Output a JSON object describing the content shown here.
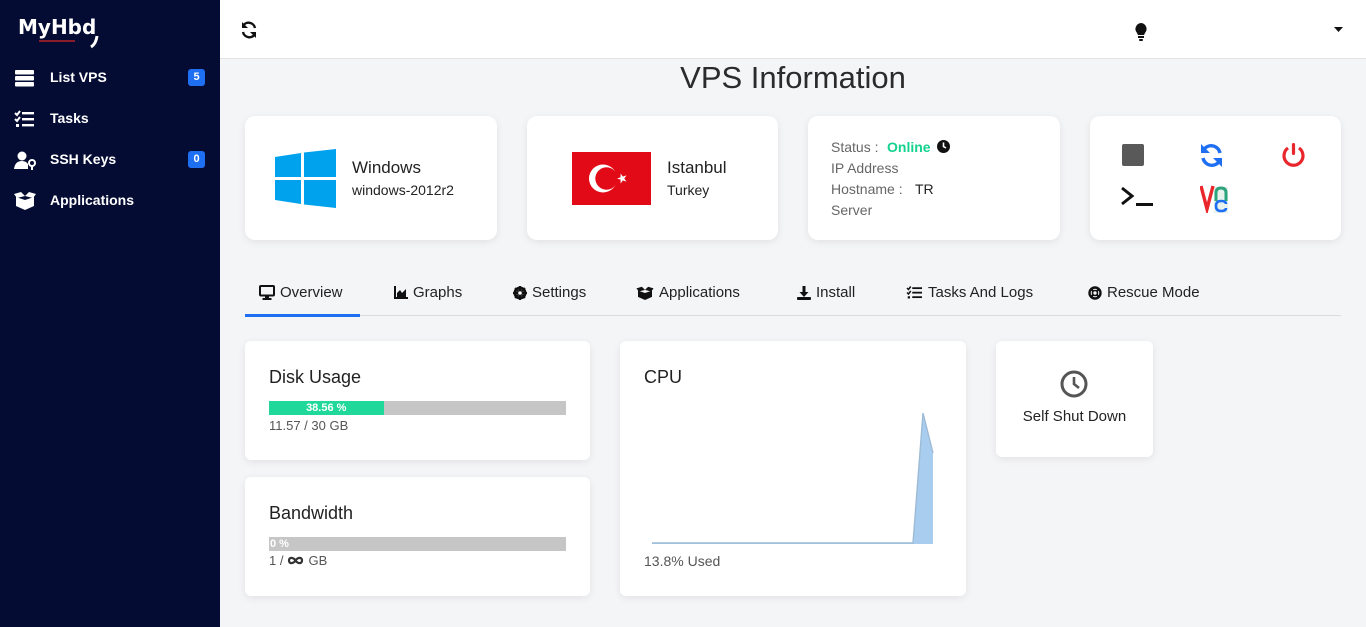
{
  "sidebar": {
    "logo_text": "MyHbd",
    "items": [
      {
        "label": "List VPS",
        "badge": "5",
        "icon": "server-icon"
      },
      {
        "label": "Tasks",
        "icon": "tasks-icon"
      },
      {
        "label": "SSH Keys",
        "badge": "0",
        "icon": "user-key-icon"
      },
      {
        "label": "Applications",
        "icon": "boxes-icon"
      }
    ]
  },
  "topbar": {
    "refresh_icon": "refresh-icon",
    "theme_icon": "lightbulb-icon",
    "user_menu_icon": "caret-down-icon"
  },
  "page": {
    "title": "VPS Information"
  },
  "os_card": {
    "name": "Windows",
    "version": "windows-2012r2",
    "icon": "windows-logo-icon"
  },
  "location_card": {
    "city": "Istanbul",
    "country": "Turkey",
    "flag": "turkey-flag"
  },
  "info_card": {
    "status_label": "Status :",
    "status_value": "Online",
    "ip_label": "IP Address",
    "hostname_label": "Hostname :",
    "hostname_value": "TR",
    "server_label": "Server"
  },
  "actions": [
    "stop-icon",
    "restart-icon",
    "power-icon",
    "console-icon",
    "vnc-icon"
  ],
  "tabs": [
    {
      "label": "Overview",
      "icon": "monitor-icon",
      "active": true
    },
    {
      "label": "Graphs",
      "icon": "area-chart-icon"
    },
    {
      "label": "Settings",
      "icon": "gear-icon"
    },
    {
      "label": "Applications",
      "icon": "boxes-icon"
    },
    {
      "label": "Install",
      "icon": "download-icon"
    },
    {
      "label": "Tasks And Logs",
      "icon": "tasks-icon"
    },
    {
      "label": "Rescue Mode",
      "icon": "life-ring-icon"
    }
  ],
  "disk": {
    "title": "Disk Usage",
    "percent_label": "38.56 %",
    "percent": 38.56,
    "usage": "11.57 / 30 GB"
  },
  "bandwidth": {
    "title": "Bandwidth",
    "percent_label": "0 %",
    "percent": 0,
    "usage_prefix": "1 /",
    "usage_suffix": "GB",
    "infinity_icon": "infinity-icon"
  },
  "cpu": {
    "title": "CPU",
    "used": "13.8% Used"
  },
  "shutdown": {
    "label": "Self Shut Down",
    "icon": "clock-icon"
  },
  "colors": {
    "sidebar": "#050c33",
    "accent": "#1e6ff1",
    "online": "#14d28f",
    "progress": "#1fd89a",
    "danger": "#e8262b"
  }
}
